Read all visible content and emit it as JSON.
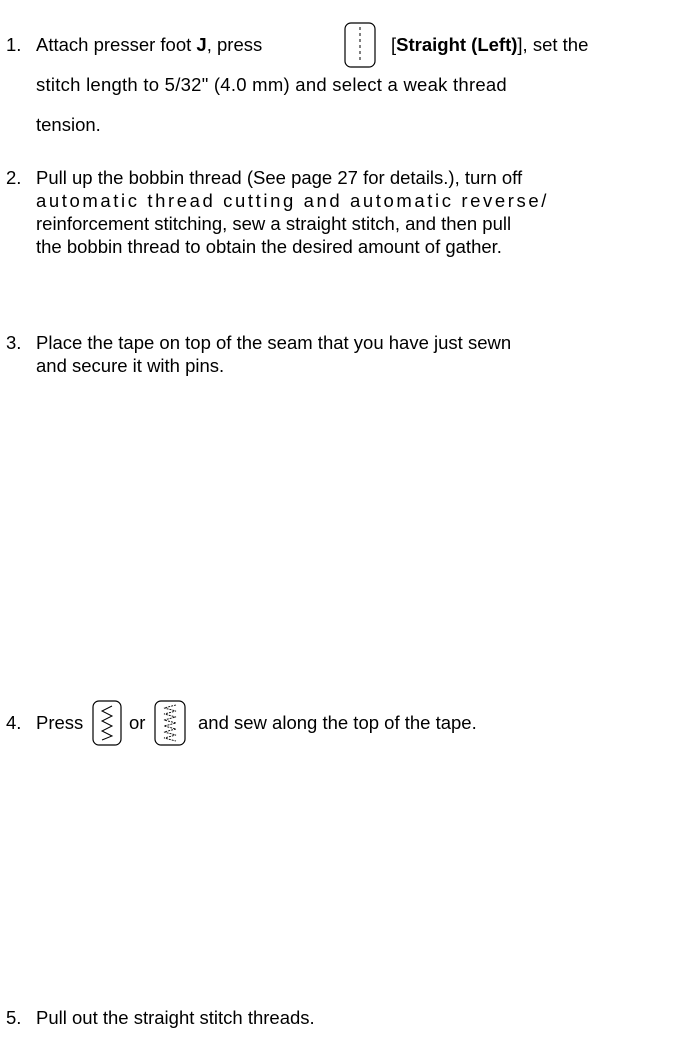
{
  "steps": [
    {
      "number": "1.",
      "lines": {
        "l1_a": "Attach presser foot ",
        "l1_b": "J",
        "l1_c": ", press",
        "l1_d": "[",
        "l1_e": "Straight (Left)",
        "l1_f": "], set the",
        "l2": "stitch length to 5/32\" (4.0 mm) and select a weak thread",
        "l3": "tension."
      },
      "icon": "straight-stitch-left-key-icon"
    },
    {
      "number": "2.",
      "lines": {
        "l1": "Pull up the bobbin thread (See page 27 for details.), turn off",
        "l2": "automatic thread cutting and automatic reverse/",
        "l3": "reinforcement stitching, sew a straight stitch, and then pull",
        "l4": "the bobbin thread to obtain the desired amount of gather."
      }
    },
    {
      "number": "3.",
      "lines": {
        "l1": "Place the tape on top of the seam that you have just sewn",
        "l2": "and secure it with pins."
      }
    },
    {
      "number": "4.",
      "lines": {
        "a": "Press",
        "b": "or",
        "c": "and sew along the top of the tape."
      },
      "icons": [
        "zigzag-stitch-key-icon",
        "multi-zigzag-stitch-key-icon"
      ]
    },
    {
      "number": "5.",
      "lines": {
        "l1": "Pull out the straight stitch threads."
      }
    }
  ]
}
